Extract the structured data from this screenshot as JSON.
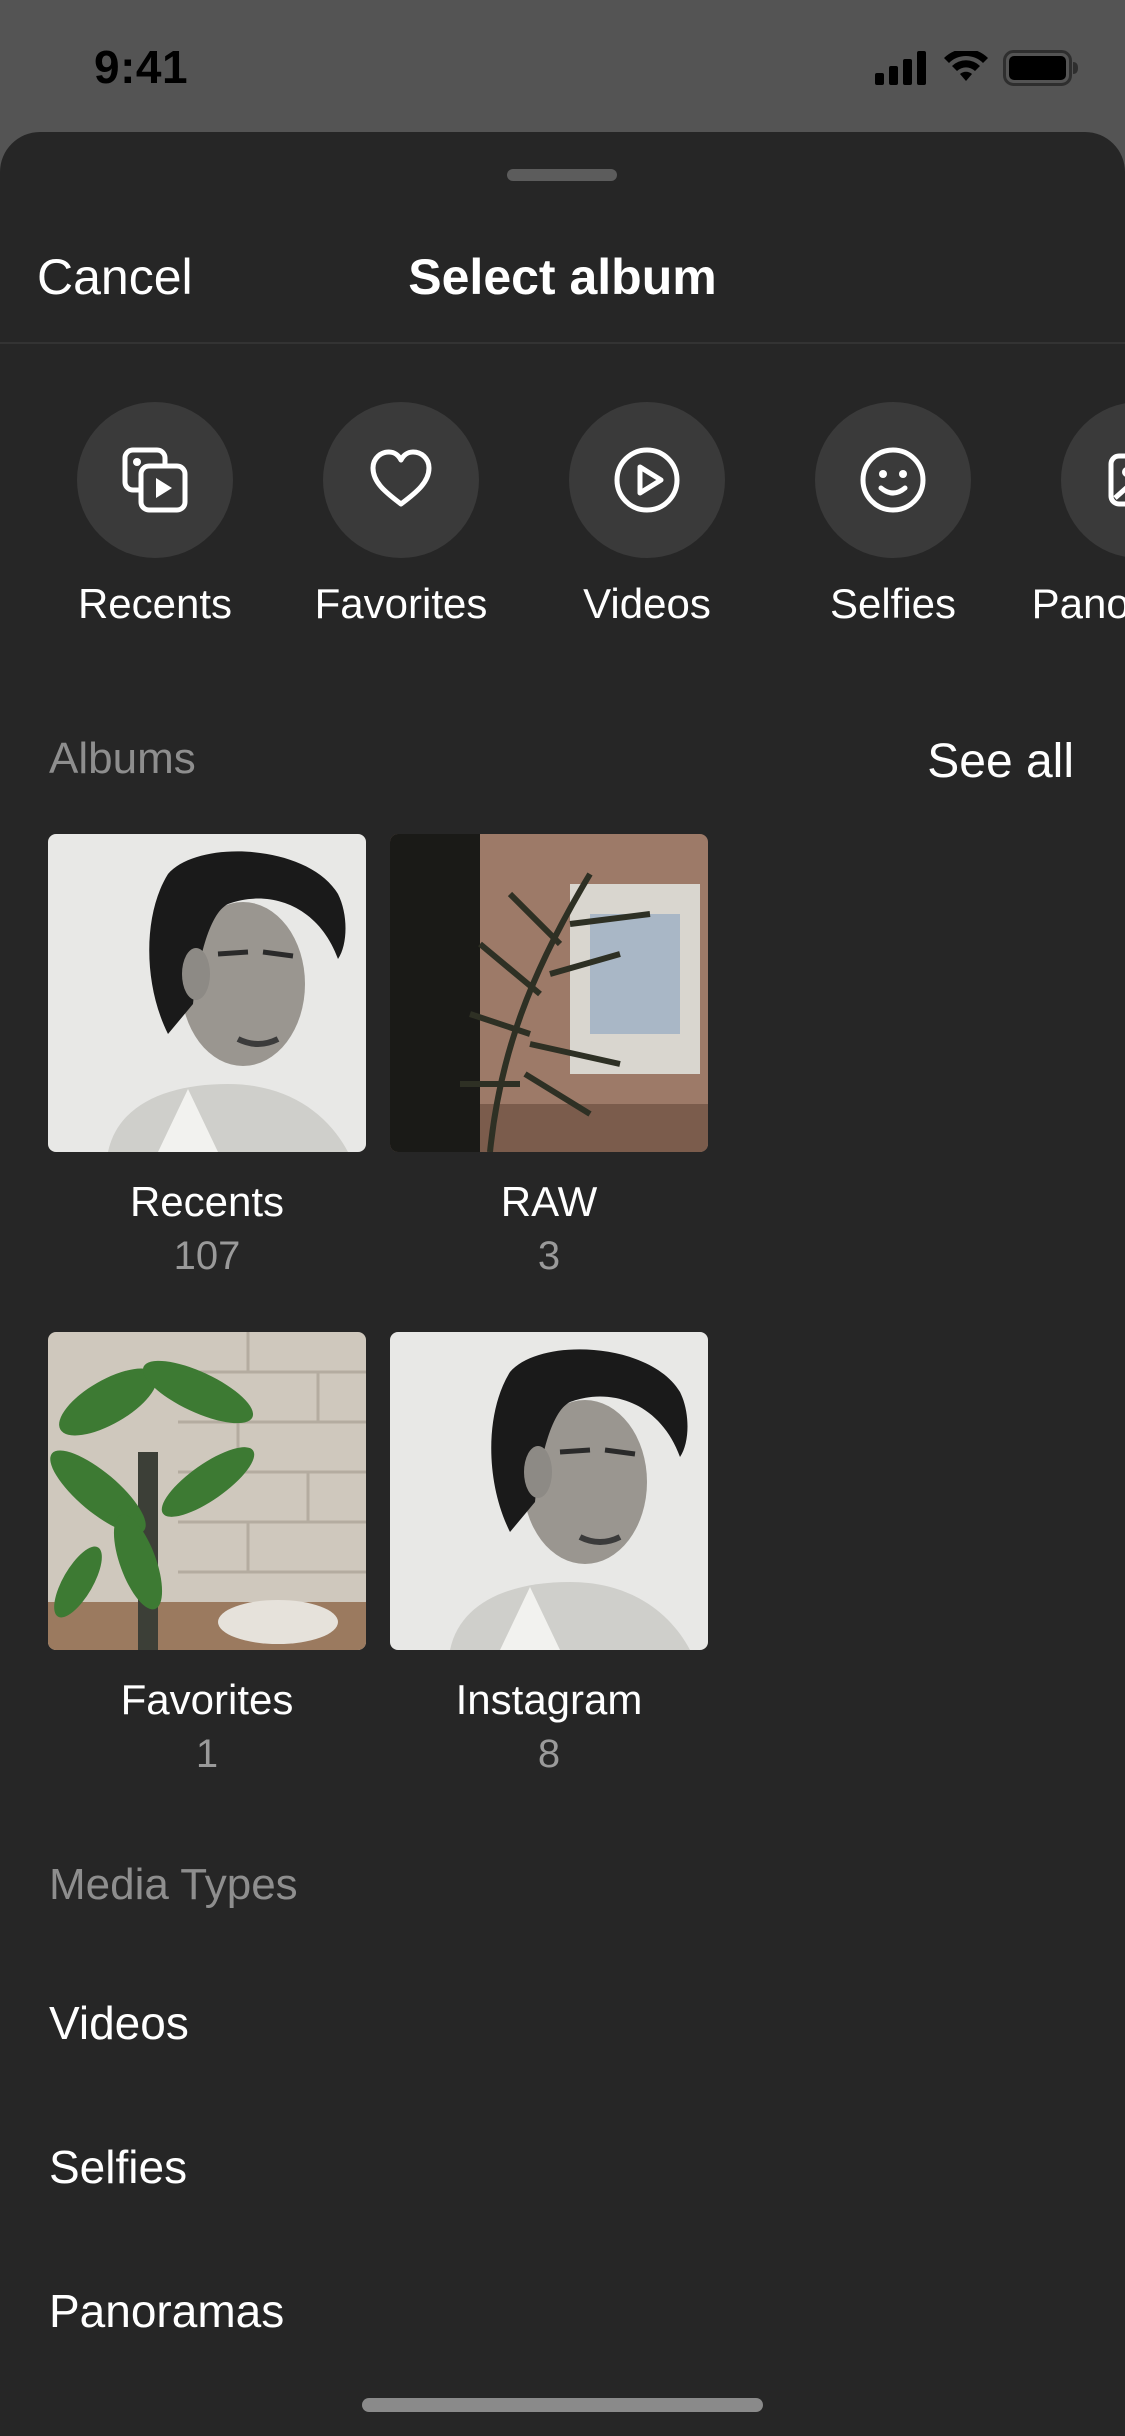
{
  "status_bar": {
    "time": "9:41"
  },
  "nav": {
    "cancel_label": "Cancel",
    "title": "Select album"
  },
  "quick_filters": [
    {
      "label": "Recents",
      "icon": "recents-icon"
    },
    {
      "label": "Favorites",
      "icon": "heart-icon"
    },
    {
      "label": "Videos",
      "icon": "play-icon"
    },
    {
      "label": "Selfies",
      "icon": "smiley-icon"
    },
    {
      "label": "Panoramas",
      "icon": "panorama-icon"
    }
  ],
  "albums_section": {
    "title": "Albums",
    "see_all_label": "See all",
    "items": [
      {
        "name": "Recents",
        "count": "107"
      },
      {
        "name": "RAW",
        "count": "3"
      },
      {
        "name": "Favorites",
        "count": "1"
      },
      {
        "name": "Instagram",
        "count": "8"
      }
    ]
  },
  "media_types": {
    "title": "Media Types",
    "items": [
      "Videos",
      "Selfies",
      "Panoramas"
    ]
  },
  "colors": {
    "sheet_background": "#262626",
    "circle_background": "#3a3a3a",
    "secondary_text": "#8e8e8e"
  }
}
